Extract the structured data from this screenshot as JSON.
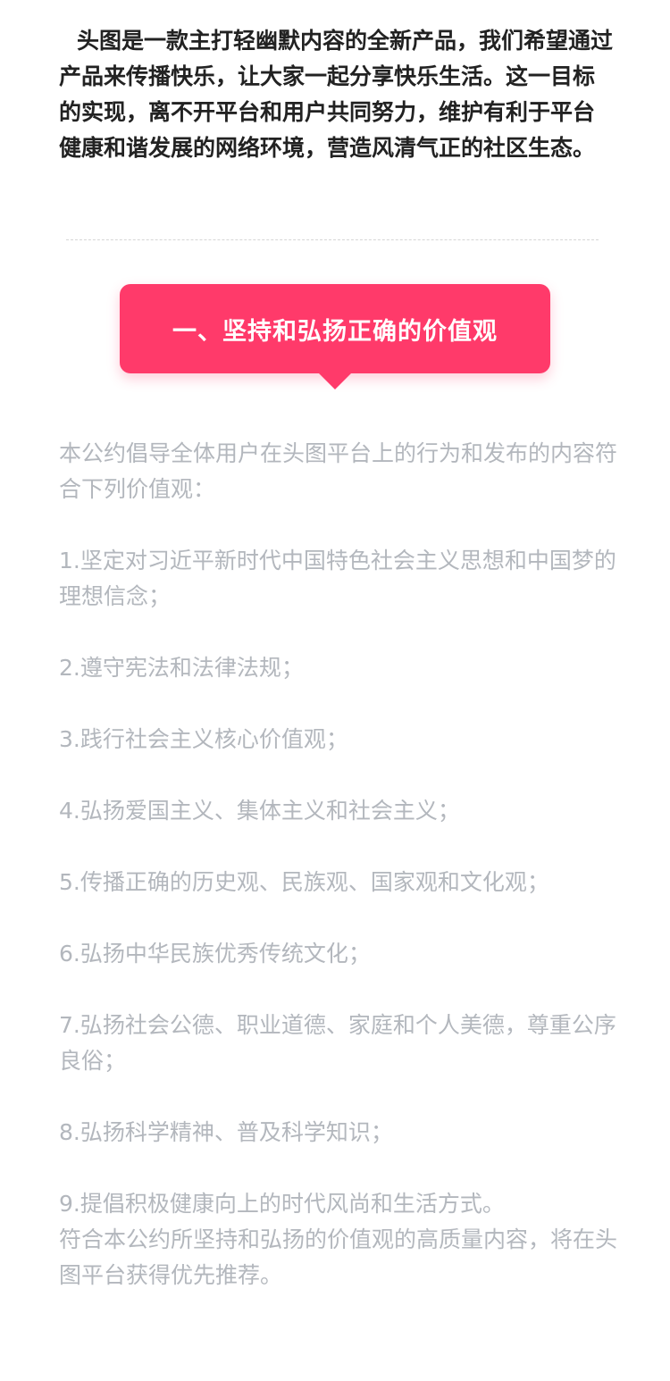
{
  "intro": {
    "text": "头图是一款主打轻幽默内容的全新产品，我们希望通过产品来传播快乐，让大家一起分享快乐生活。这一目标的实现，离不开平台和用户共同努力，维护有利于平台健康和谐发展的网络环境，营造风清气正的社区生态。"
  },
  "section": {
    "title": "一、坚持和弘扬正确的价值观"
  },
  "content": {
    "lead": "本公约倡导全体用户在头图平台上的行为和发布的内容符合下列价值观：",
    "items": [
      "1.坚定对习近平新时代中国特色社会主义思想和中国梦的理想信念；",
      "2.遵守宪法和法律法规；",
      "3.践行社会主义核心价值观；",
      "4.弘扬爱国主义、集体主义和社会主义；",
      "5.传播正确的历史观、民族观、国家观和文化观；",
      "6.弘扬中华民族优秀传统文化；",
      "7.弘扬社会公德、职业道德、家庭和个人美德，尊重公序良俗；",
      "8.弘扬科学精神、普及科学知识；",
      "9.提倡积极健康向上的时代风尚和生活方式。"
    ],
    "closing": "符合本公约所坚持和弘扬的价值观的高质量内容，将在头图平台获得优先推荐。"
  }
}
